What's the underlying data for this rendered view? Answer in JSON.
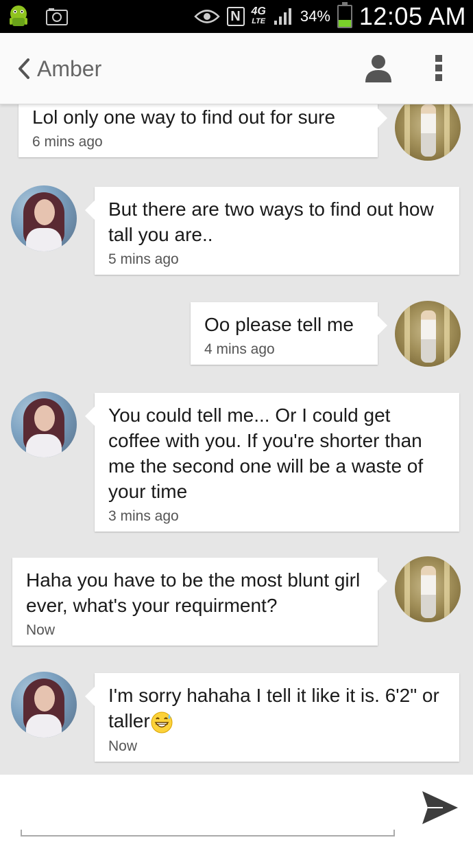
{
  "status_bar": {
    "network": "4G",
    "network_sub": "LTE",
    "battery_pct": "34%",
    "battery_level": 0.34,
    "time": "12:05 AM",
    "icons": [
      "android-icon",
      "camera-icon",
      "eye-icon",
      "nfc-icon",
      "signal-icon",
      "battery-icon"
    ]
  },
  "header": {
    "back_icon": "chevron-left-icon",
    "contact_name": "Amber",
    "profile_icon": "person-icon",
    "menu_icon": "more-vert-icon"
  },
  "messages": [
    {
      "from": "me",
      "text": "Lol only one way to find out for sure",
      "time": "6 mins ago"
    },
    {
      "from": "them",
      "text": "But there are two ways to find out how tall you are..",
      "time": "5 mins ago"
    },
    {
      "from": "me",
      "text": "Oo please tell me",
      "time": "4 mins ago"
    },
    {
      "from": "them",
      "text": "You could tell me... Or I could get coffee with you. If you're shorter than me the second one will be a waste of your time",
      "time": "3 mins ago"
    },
    {
      "from": "me",
      "text": "Haha you have to be the most blunt girl ever, what's your requirment?",
      "time": "Now"
    },
    {
      "from": "them",
      "text": "I'm sorry hahaha I tell it like it is. 6'2\" or taller",
      "emoji": "grinning-sweat-emoji",
      "time": "Now"
    }
  ],
  "composer": {
    "value": "",
    "send_icon": "send-icon"
  },
  "colors": {
    "status_bar": "#000000",
    "header_bg": "#fafafa",
    "chat_bg": "#e6e6e6",
    "bubble_bg": "#ffffff",
    "battery": "#7ad12a"
  }
}
